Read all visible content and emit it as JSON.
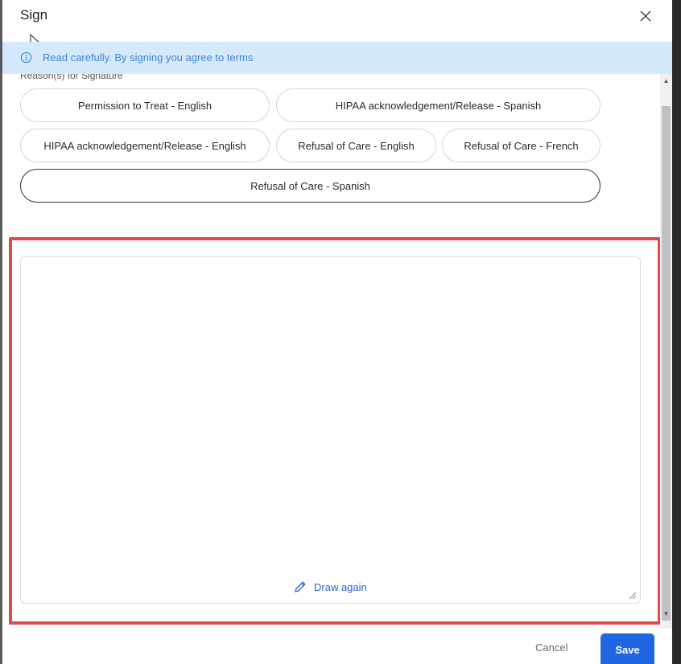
{
  "dialog": {
    "title": "Sign"
  },
  "banner": {
    "text": "Read carefully. By signing you agree to terms"
  },
  "reasons": {
    "label": "Reason(s) for Signature",
    "options": [
      {
        "label": "Permission to Treat - English",
        "selected": false
      },
      {
        "label": "HIPAA acknowledgement/Release - Spanish",
        "selected": false
      },
      {
        "label": "HIPAA acknowledgement/Release - English",
        "selected": false
      },
      {
        "label": "Refusal of Care - English",
        "selected": false
      },
      {
        "label": "Refusal of Care - French",
        "selected": false
      },
      {
        "label": "Refusal of Care - Spanish",
        "selected": true
      }
    ]
  },
  "signature_pad": {
    "draw_again_label": "Draw again"
  },
  "footer": {
    "cancel_label": "Cancel",
    "save_label": "Save"
  },
  "colors": {
    "banner_bg": "#d6e8fb",
    "banner_text": "#3a86d8",
    "primary": "#1f66e0",
    "highlight": "#e04a4a"
  }
}
